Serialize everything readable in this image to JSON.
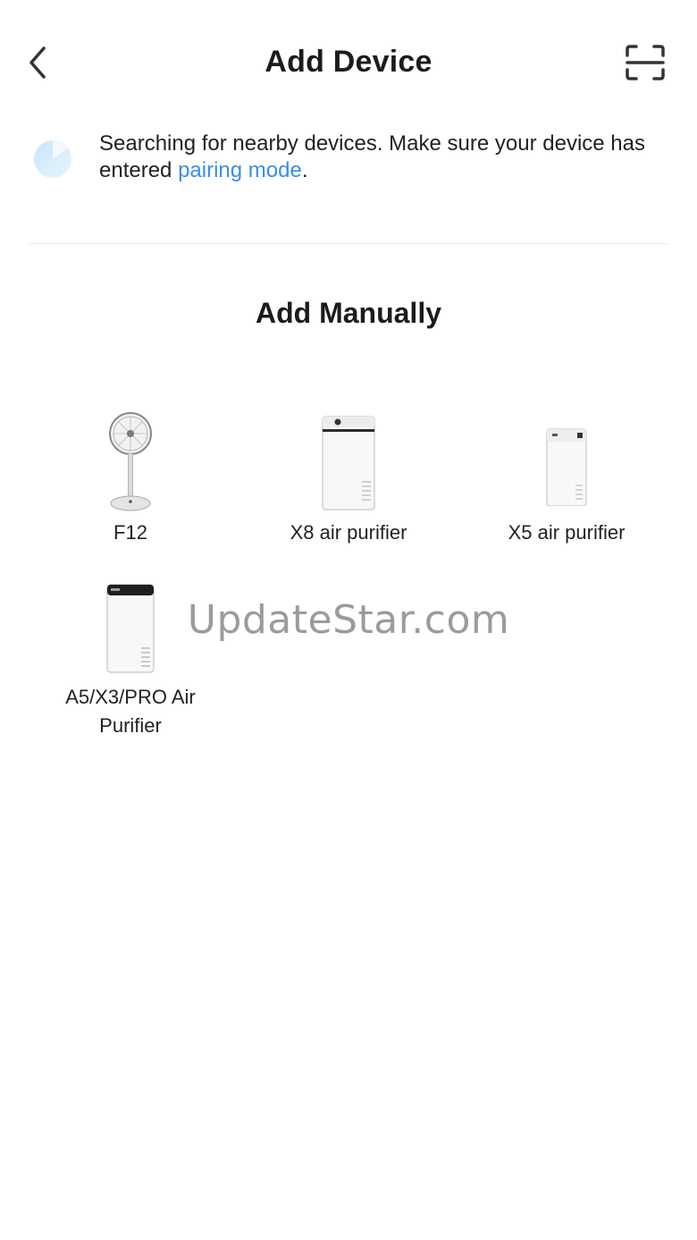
{
  "header": {
    "title": "Add Device",
    "back_icon": "chevron-left-icon",
    "scan_icon": "scan-icon"
  },
  "search_banner": {
    "text_before": "Searching for nearby devices. Make sure your device has entered ",
    "link_text": "pairing mode",
    "text_after": ".",
    "link_color": "#3a8ee6"
  },
  "manual": {
    "title": "Add Manually",
    "devices": [
      {
        "name": "F12",
        "icon": "fan-icon"
      },
      {
        "name": "X8 air purifier",
        "icon": "air-purifier-icon"
      },
      {
        "name": "X5 air purifier",
        "icon": "air-purifier-icon"
      },
      {
        "name": "A5/X3/PRO Air Purifier",
        "icon": "air-purifier-icon"
      }
    ]
  },
  "watermark": "UpdateStar.com"
}
